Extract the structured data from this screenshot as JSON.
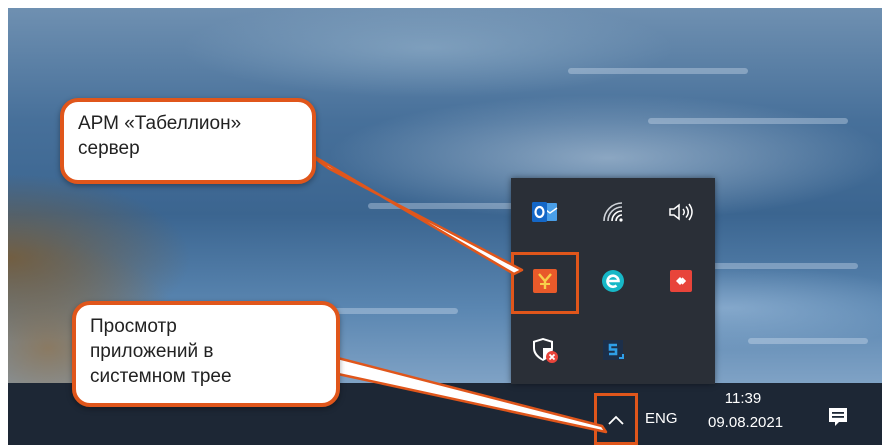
{
  "callouts": {
    "server": {
      "line1": "АРМ «Табеллион»",
      "line2": "сервер"
    },
    "tray": {
      "line1": "Просмотр",
      "line2": "приложений в",
      "line3": "системном трее"
    }
  },
  "taskbar": {
    "language": "ENG",
    "time": "11:39",
    "date": "09.08.2021"
  },
  "tray_icons": [
    {
      "name": "outlook-icon",
      "color": "#1467c7"
    },
    {
      "name": "wifi-icon",
      "color": "#ffffff"
    },
    {
      "name": "volume-icon",
      "color": "#ffffff"
    },
    {
      "name": "tabellion-server-icon",
      "color": "#e85a2a"
    },
    {
      "name": "edge-e-icon",
      "color": "#17b8c7"
    },
    {
      "name": "red-app-icon",
      "color": "#e8443a"
    },
    {
      "name": "security-shield-icon",
      "color": "#ffffff"
    },
    {
      "name": "s-app-icon",
      "color": "#2f7fd0"
    }
  ],
  "colors": {
    "highlight": "#e0561b",
    "taskbar": "#1d2735",
    "popup": "#2a2f37"
  }
}
